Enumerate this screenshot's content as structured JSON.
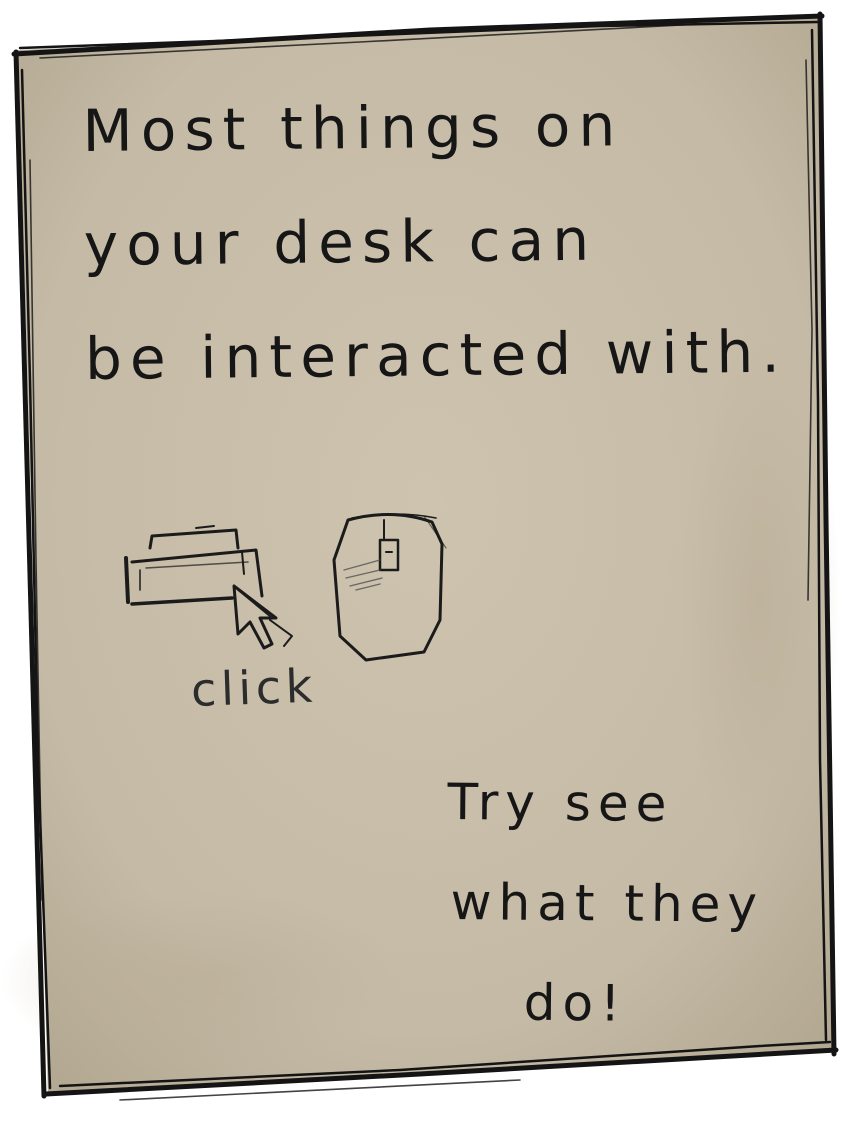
{
  "note": {
    "headline_lines": [
      "Most things on",
      "your desk can",
      "be interacted with."
    ],
    "illustration": {
      "printer_icon": "printer-icon",
      "cursor_icon": "mouse-pointer-icon",
      "mouse_icon": "computer-mouse-icon",
      "caption": "click"
    },
    "outro_lines": [
      "Try see",
      "what they",
      "do!"
    ]
  },
  "colors": {
    "paper": "#c7bda9",
    "paper_edge": "#b4a993",
    "ink": "#161616",
    "pencil": "#2c2c2c",
    "backdrop": "#ffffff"
  }
}
